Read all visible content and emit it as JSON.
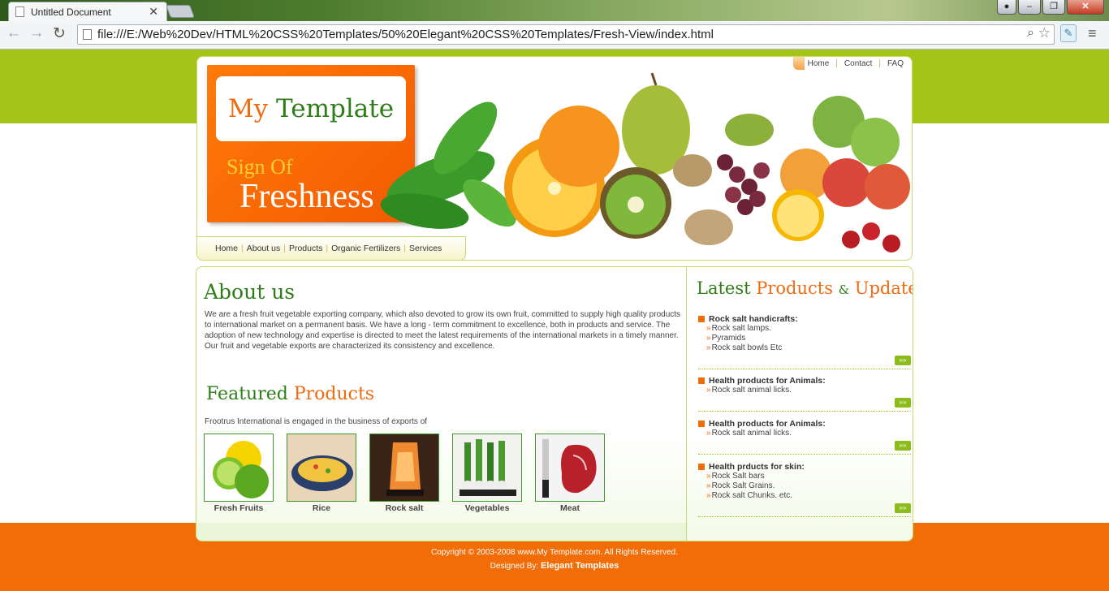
{
  "browser": {
    "tab_title": "Untitled Document",
    "tab_close": "✕",
    "url": "file:///E:/Web%20Dev/HTML%20CSS%20Templates/50%20Elegant%20CSS%20Templates/Fresh-View/index.html",
    "icons": [
      "back-icon",
      "forward-icon",
      "reload-icon",
      "page-icon",
      "zoom-icon",
      "star-icon",
      "extension-icon",
      "menu-icon"
    ]
  },
  "header": {
    "top_nav": [
      "Home",
      "Contact",
      "FAQ"
    ],
    "logo_my": "My",
    "logo_template": "Template",
    "tagline_top": "Sign Of",
    "tagline_bottom": "Freshness",
    "main_nav": [
      "Home",
      "About us",
      "Products",
      "Organic Fertilizers",
      "Services"
    ]
  },
  "about": {
    "heading": "About us",
    "text": "We are a fresh fruit vegetable exporting company, which also devoted to grow its own fruit, committed to supply high quality products to international market on a permanent basis. We have a long - term commitment to excellence, both in products and service. The adoption of new technology and expertise is directed to meet the latest requirements of the international markets in a timely manner. Our fruit and vegetable exports are characterized its consistency and excellence."
  },
  "featured": {
    "heading_a": "Featured",
    "heading_b": "Products",
    "intro": "Frootrus International is engaged in the business of exports of",
    "items": [
      "Fresh Fruits",
      "Rice",
      "Rock salt",
      "Vegetables",
      "Meat"
    ]
  },
  "latest": {
    "heading_a": "Latest",
    "heading_b": "Products",
    "heading_amp": "&",
    "heading_c": "Updates",
    "news": [
      {
        "title": "Rock salt handicrafts:",
        "items": [
          "Rock salt lamps.",
          "Pyramids",
          "Rock salt bowls Etc"
        ]
      },
      {
        "title": "Health products for Animals:",
        "items": [
          "Rock salt animal licks."
        ]
      },
      {
        "title": "Health products for Animals:",
        "items": [
          "Rock salt animal licks."
        ]
      },
      {
        "title": "Health prducts for skin:",
        "items": [
          "Rock Salt bars",
          "Rock Salt Grains.",
          "Rock salt Chunks. etc."
        ]
      }
    ],
    "more_label": "»»"
  },
  "footer": {
    "copyright": "Copyright © 2003-2008 www.My Template.com. All Rights Reserved.",
    "designed_by": "Designed By:",
    "designer": "Elegant Templates"
  }
}
